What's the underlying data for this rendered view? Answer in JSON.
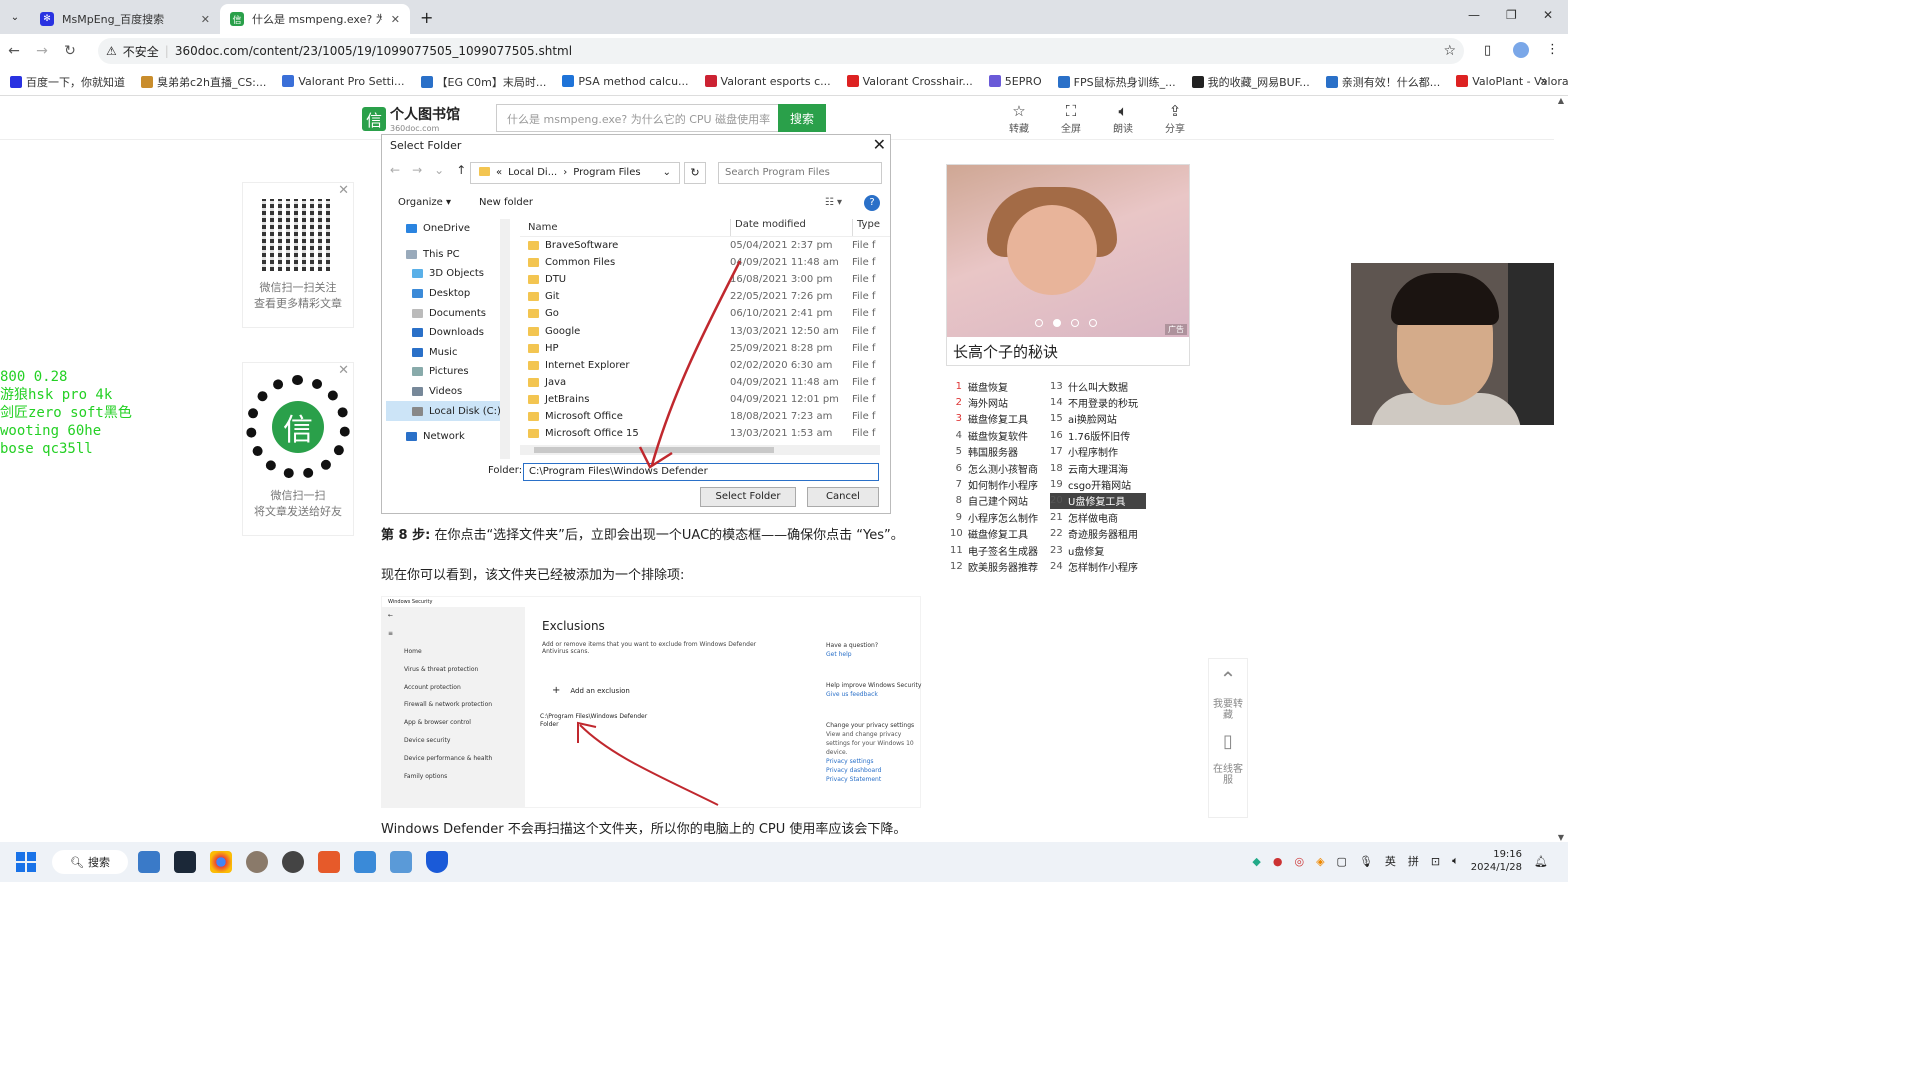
{
  "browser": {
    "tabs": [
      {
        "title": "MsMpEng_百度搜索",
        "active": false
      },
      {
        "title": "什么是 msmpeng.exe? 为什么",
        "active": true
      }
    ],
    "security_label": "不安全",
    "url": "360doc.com/content/23/1005/19/1099077505_1099077505.shtml",
    "bookmarks": [
      "百度一下，你就知道",
      "臭弟弟c2h直播_CS:...",
      "Valorant Pro Setti...",
      "【EG C0m】末局时...",
      "PSA method calcu...",
      "Valorant esports c...",
      "Valorant Crosshair...",
      "5EPRO",
      "FPS鼠标热身训练_...",
      "我的收藏_网易BUF...",
      "亲测有效！什么都...",
      "ValoPlant - Valora..."
    ]
  },
  "site": {
    "logo_text": "个人图书馆",
    "logo_sub": "360doc.com",
    "search_placeholder": "什么是 msmpeng.exe? 为什么它的 CPU 磁盘使用率",
    "search_button": "搜索",
    "actions": [
      {
        "label": "转藏",
        "icon": "star-icon"
      },
      {
        "label": "全屏",
        "icon": "fullscreen-icon"
      },
      {
        "label": "朗读",
        "icon": "speaker-icon"
      },
      {
        "label": "分享",
        "icon": "share-icon"
      }
    ]
  },
  "dialog": {
    "title": "Select Folder",
    "path": [
      "Local Di...",
      "Program Files"
    ],
    "search_placeholder": "Search Program Files",
    "organize": "Organize",
    "new_folder": "New folder",
    "tree": [
      "OneDrive",
      "This PC",
      "3D Objects",
      "Desktop",
      "Documents",
      "Downloads",
      "Music",
      "Pictures",
      "Videos",
      "Local Disk (C:)",
      "Network"
    ],
    "columns": [
      "Name",
      "Date modified",
      "Type"
    ],
    "files": [
      {
        "name": "BraveSoftware",
        "date": "05/04/2021 2:37 pm",
        "type": "File f"
      },
      {
        "name": "Common Files",
        "date": "04/09/2021 11:48 am",
        "type": "File f"
      },
      {
        "name": "DTU",
        "date": "16/08/2021 3:00 pm",
        "type": "File f"
      },
      {
        "name": "Git",
        "date": "22/05/2021 7:26 pm",
        "type": "File f"
      },
      {
        "name": "Go",
        "date": "06/10/2021 2:41 pm",
        "type": "File f"
      },
      {
        "name": "Google",
        "date": "13/03/2021 12:50 am",
        "type": "File f"
      },
      {
        "name": "HP",
        "date": "25/09/2021 8:28 pm",
        "type": "File f"
      },
      {
        "name": "Internet Explorer",
        "date": "02/02/2020 6:30 am",
        "type": "File f"
      },
      {
        "name": "Java",
        "date": "04/09/2021 11:48 am",
        "type": "File f"
      },
      {
        "name": "JetBrains",
        "date": "04/09/2021 12:01 pm",
        "type": "File f"
      },
      {
        "name": "Microsoft Office",
        "date": "18/08/2021 7:23 am",
        "type": "File f"
      },
      {
        "name": "Microsoft Office 15",
        "date": "13/03/2021 1:53 am",
        "type": "File f"
      }
    ],
    "folder_label": "Folder:",
    "folder_value": "C:\\Program Files\\Windows Defender",
    "select_button": "Select Folder",
    "cancel_button": "Cancel"
  },
  "article": {
    "step_label": "第 8 步:",
    "step_text": "在你点击“选择文件夹”后，立即会出现一个UAC的模态框——确保你点击 “Yes”。",
    "para": "现在你可以看到，该文件夹已经被添加为一个排除项:",
    "bottom": "Windows Defender 不会再扫描这个文件夹，所以你的电脑上的 CPU 使用率应该会下降。"
  },
  "exclusions": {
    "app": "Windows Security",
    "nav": [
      "Home",
      "Virus & threat protection",
      "Account protection",
      "Firewall & network protection",
      "App & browser control",
      "Device security",
      "Device performance & health",
      "Family options"
    ],
    "title": "Exclusions",
    "desc": "Add or remove items that you want to exclude from Windows Defender Antivirus scans.",
    "add": "Add an exclusion",
    "path": "C:\\Program Files\\Windows Defender",
    "path_type": "Folder",
    "right": [
      {
        "h": "Have a question?",
        "l": "Get help"
      },
      {
        "h": "Help improve Windows Security",
        "l": "Give us feedback"
      },
      {
        "h": "Change your privacy settings",
        "t": "View and change privacy settings for your Windows 10 device.",
        "l": "Privacy settings"
      }
    ],
    "links": [
      "Privacy dashboard",
      "Privacy Statement"
    ]
  },
  "qr": {
    "caption1a": "微信扫一扫关注",
    "caption1b": "查看更多精彩文章",
    "caption2a": "微信扫一扫",
    "caption2b": "将文章发送给好友"
  },
  "overlay": [
    "800 0.28",
    "游狼hsk pro 4k",
    "剑匠zero soft黑色",
    "wooting 60he",
    "bose qc35ll"
  ],
  "ad": {
    "title": "长高个子的秘诀",
    "tag": "广告"
  },
  "rank": [
    {
      "n": "1",
      "t": "磁盘恢复"
    },
    {
      "n": "13",
      "t": "什么叫大数据"
    },
    {
      "n": "2",
      "t": "海外网站"
    },
    {
      "n": "14",
      "t": "不用登录的秒玩"
    },
    {
      "n": "3",
      "t": "磁盘修复工具"
    },
    {
      "n": "15",
      "t": "ai换脸网站"
    },
    {
      "n": "4",
      "t": "磁盘恢复软件"
    },
    {
      "n": "16",
      "t": "1.76版怀旧传"
    },
    {
      "n": "5",
      "t": "韩国服务器"
    },
    {
      "n": "17",
      "t": "小程序制作"
    },
    {
      "n": "6",
      "t": "怎么测小孩智商"
    },
    {
      "n": "18",
      "t": "云南大理洱海"
    },
    {
      "n": "7",
      "t": "如何制作小程序"
    },
    {
      "n": "19",
      "t": "csgo开箱网站"
    },
    {
      "n": "8",
      "t": "自己建个网站"
    },
    {
      "n": "20",
      "t": "U盘修复工具"
    },
    {
      "n": "9",
      "t": "小程序怎么制作"
    },
    {
      "n": "21",
      "t": "怎样做电商"
    },
    {
      "n": "10",
      "t": "磁盘修复工具"
    },
    {
      "n": "22",
      "t": "奇迹服务器租用"
    },
    {
      "n": "11",
      "t": "电子签名生成器"
    },
    {
      "n": "23",
      "t": "u盘修复"
    },
    {
      "n": "12",
      "t": "欧美服务器推荐"
    },
    {
      "n": "24",
      "t": "怎样制作小程序"
    }
  ],
  "side": {
    "collect": "我要转藏",
    "service": "在线客服"
  },
  "taskbar": {
    "search": "搜索",
    "lang": "英",
    "ime": "拼",
    "time": "19:16",
    "date": "2024/1/28"
  }
}
